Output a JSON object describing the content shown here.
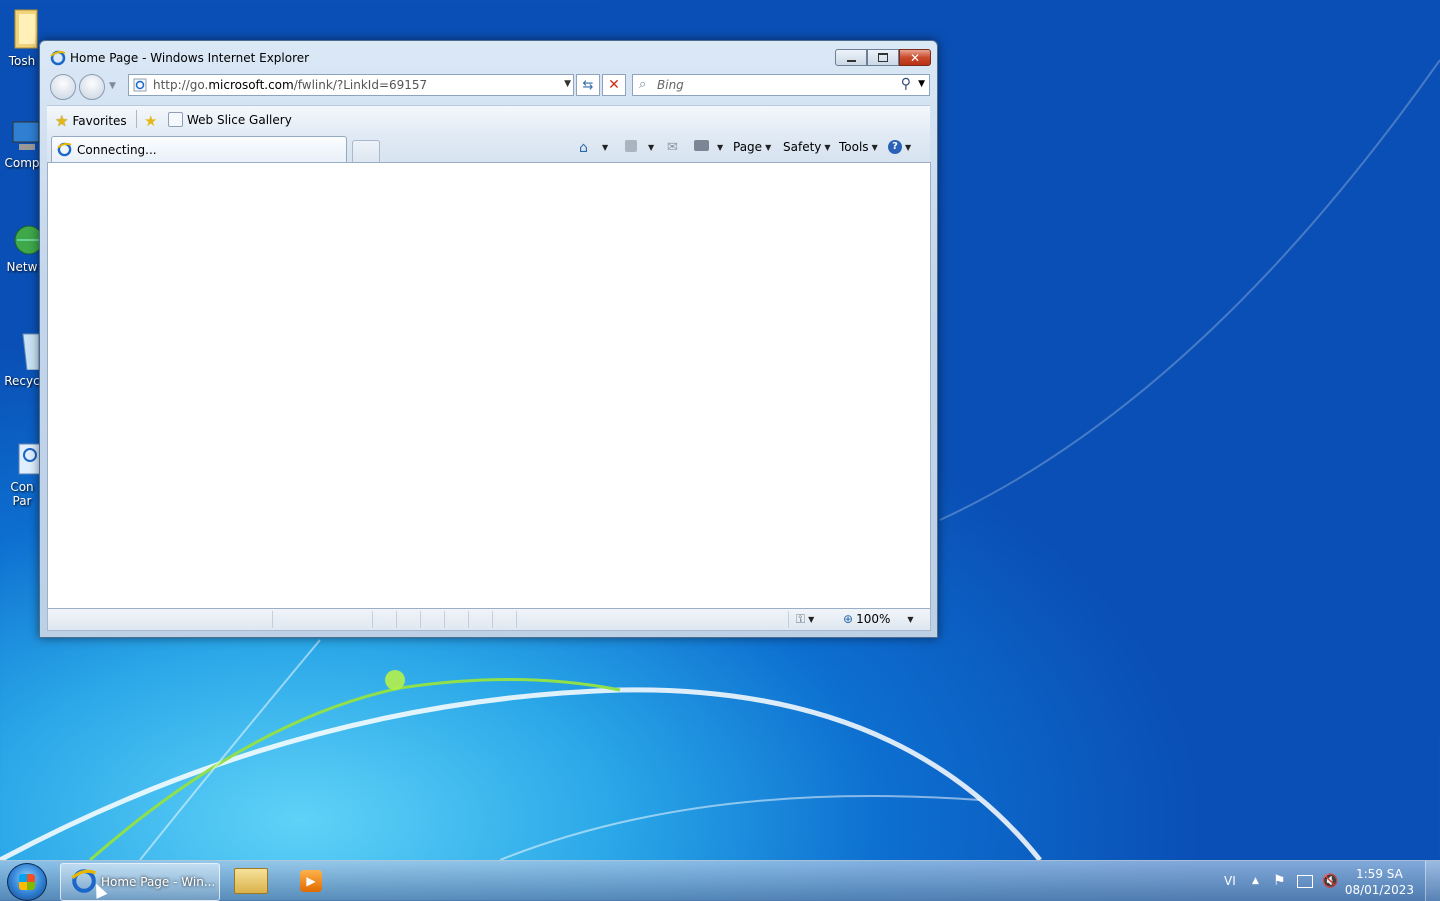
{
  "desktop": {
    "icons": [
      {
        "label": "Tosh"
      },
      {
        "label": "Comp"
      },
      {
        "label": "Netw"
      },
      {
        "label": "Recyc"
      },
      {
        "label": "Con",
        "label2": "Par"
      }
    ]
  },
  "window": {
    "title": "Home Page - Windows Internet Explorer",
    "address": {
      "prefix": "http://go.",
      "domain": "microsoft.com",
      "suffix": "/fwlink/?LinkId=69157"
    },
    "search_placeholder": "Bing",
    "favorites": {
      "label": "Favorites",
      "web_slice": "Web Slice Gallery"
    },
    "tab": {
      "label": "Connecting..."
    },
    "commands": {
      "page": "Page",
      "safety": "Safety",
      "tools": "Tools"
    },
    "status": {
      "zoom": "100%"
    }
  },
  "taskbar": {
    "active_item": "Home Page - Win...",
    "language": "VI",
    "time": "1:59 SA",
    "date": "08/01/2023"
  },
  "colors": {
    "accent": "#1a66c9",
    "close": "#c94a2b"
  }
}
